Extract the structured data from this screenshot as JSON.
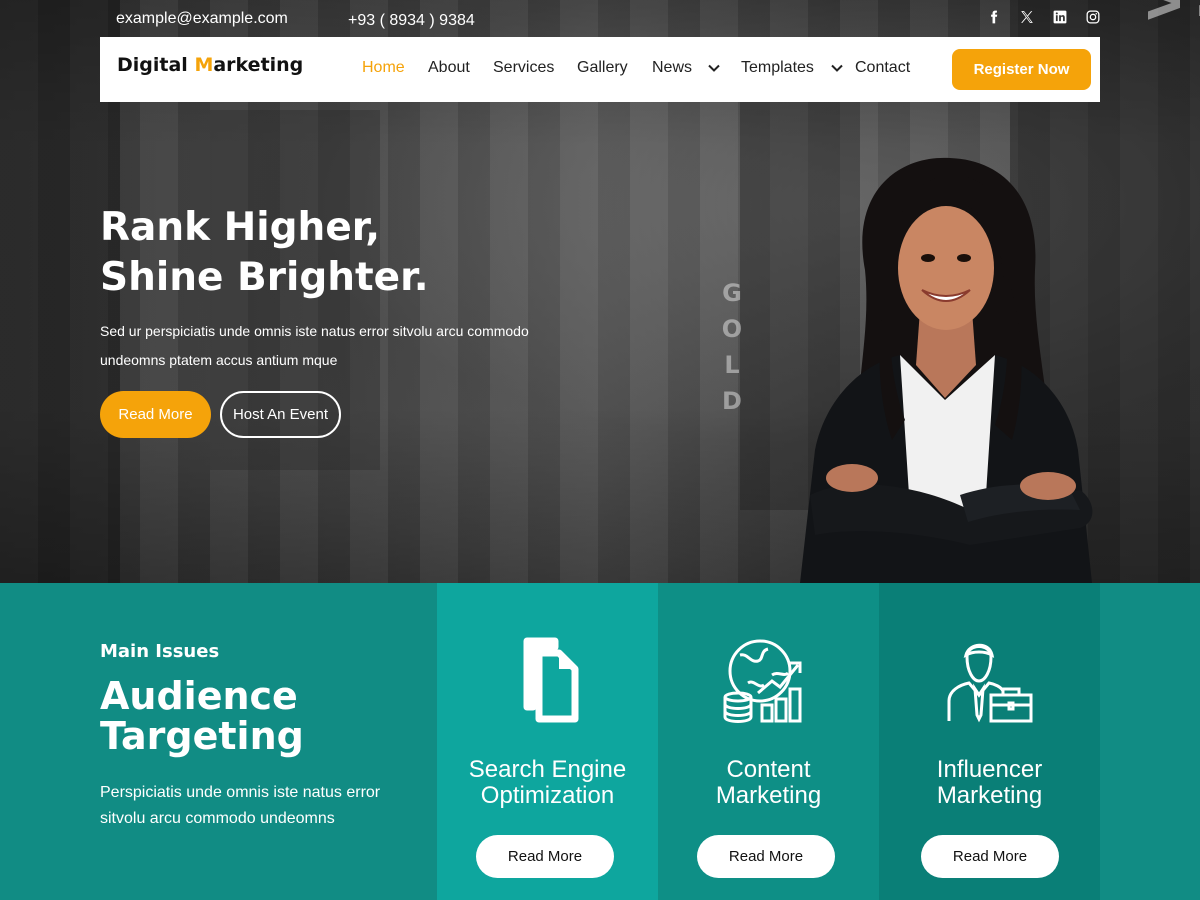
{
  "topbar": {
    "email": "example@example.com",
    "phone": "+93 ( 8934 ) 9384",
    "socials": [
      "facebook-icon",
      "x-icon",
      "linkedin-icon",
      "instagram-icon"
    ]
  },
  "brand": {
    "part1": "Digital ",
    "accent": "M",
    "part2": "arketing"
  },
  "nav": {
    "items": [
      {
        "label": "Home",
        "active": true
      },
      {
        "label": "About"
      },
      {
        "label": "Services"
      },
      {
        "label": "Gallery"
      },
      {
        "label": "News",
        "has_dropdown": true
      },
      {
        "label": "Templates",
        "has_dropdown": true
      },
      {
        "label": "Contact"
      }
    ],
    "cta": "Register Now"
  },
  "hero": {
    "title_line1": "Rank Higher,",
    "title_line2": "Shine Brighter.",
    "desc_line1": "Sed ur perspiciatis unde omnis iste natus error sitvolu arcu commodo",
    "desc_line2": "undeomns  ptatem accus antium mque",
    "read_more": "Read More",
    "host_event": "Host An Event"
  },
  "background_signs": {
    "vero": "VERO M",
    "gold": [
      "G",
      "O",
      "L",
      "D"
    ]
  },
  "issues": {
    "kicker": "Main Issues",
    "title_line1": "Audience",
    "title_line2": "Targeting",
    "text": "Perspiciatis unde omnis iste natus error sitvolu arcu commodo undeomns"
  },
  "cards": [
    {
      "icon": "document-icon",
      "title_line1": "Search Engine",
      "title_line2": "Optimization",
      "button": "Read More"
    },
    {
      "icon": "globe-growth-icon",
      "title_line1": "Content",
      "title_line2": "Marketing",
      "button": "Read More"
    },
    {
      "icon": "businessman-icon",
      "title_line1": "Influencer",
      "title_line2": "Marketing",
      "button": "Read More"
    }
  ],
  "colors": {
    "accent": "#f5a30a",
    "teal_dark": "#118c84",
    "teal_card1": "#0ea69e",
    "teal_card2": "#0e8f86",
    "teal_card3": "#0a7f77"
  }
}
